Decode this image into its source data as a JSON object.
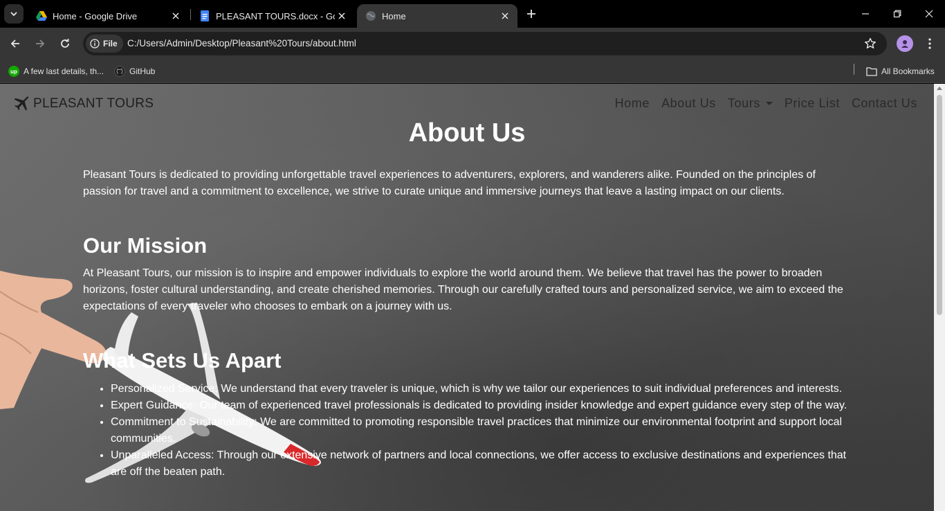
{
  "browser": {
    "tabs": [
      {
        "title": "Home - Google Drive",
        "icon": "google-drive-icon",
        "active": false
      },
      {
        "title": "PLEASANT TOURS.docx - Goog",
        "icon": "google-docs-icon",
        "active": false
      },
      {
        "title": "Home",
        "icon": "globe-icon",
        "active": true
      }
    ],
    "address": {
      "chip_label": "File",
      "url": "C:/Users/Admin/Desktop/Pleasant%20Tours/about.html"
    },
    "bookmarks": [
      {
        "label": "A few last details, th...",
        "icon": "upwork-icon"
      },
      {
        "label": "GitHub",
        "icon": "github-icon"
      }
    ],
    "all_bookmarks_label": "All Bookmarks"
  },
  "site": {
    "brand": "PLEASANT TOURS",
    "nav": [
      "Home",
      "About Us",
      "Tours",
      "Price List",
      "Contact Us"
    ]
  },
  "page": {
    "title": "About Us",
    "intro": "Pleasant Tours is dedicated to providing unforgettable travel experiences to adventurers, explorers, and wanderers alike. Founded on the principles of passion for travel and a commitment to excellence, we strive to curate unique and immersive journeys that leave a lasting impact on our clients.",
    "mission_heading": "Our Mission",
    "mission_text": "At Pleasant Tours, our mission is to inspire and empower individuals to explore the world around them. We believe that travel has the power to broaden horizons, foster cultural understanding, and create cherished memories. Through our carefully crafted tours and personalized service, we aim to exceed the expectations of every traveler who chooses to embark on a journey with us.",
    "apart_heading": "What Sets Us Apart",
    "apart_items": [
      "Personalized Service: We understand that every traveler is unique, which is why we tailor our experiences to suit individual preferences and interests.",
      "Expert Guidance: Our team of experienced travel professionals is dedicated to providing insider knowledge and expert guidance every step of the way.",
      "Commitment to Sustainability: We are committed to promoting responsible travel practices that minimize our environmental footprint and support local communities.",
      "Unparalleled Access: Through our extensive network of partners and local connections, we offer access to exclusive destinations and experiences that are off the beaten path."
    ]
  }
}
